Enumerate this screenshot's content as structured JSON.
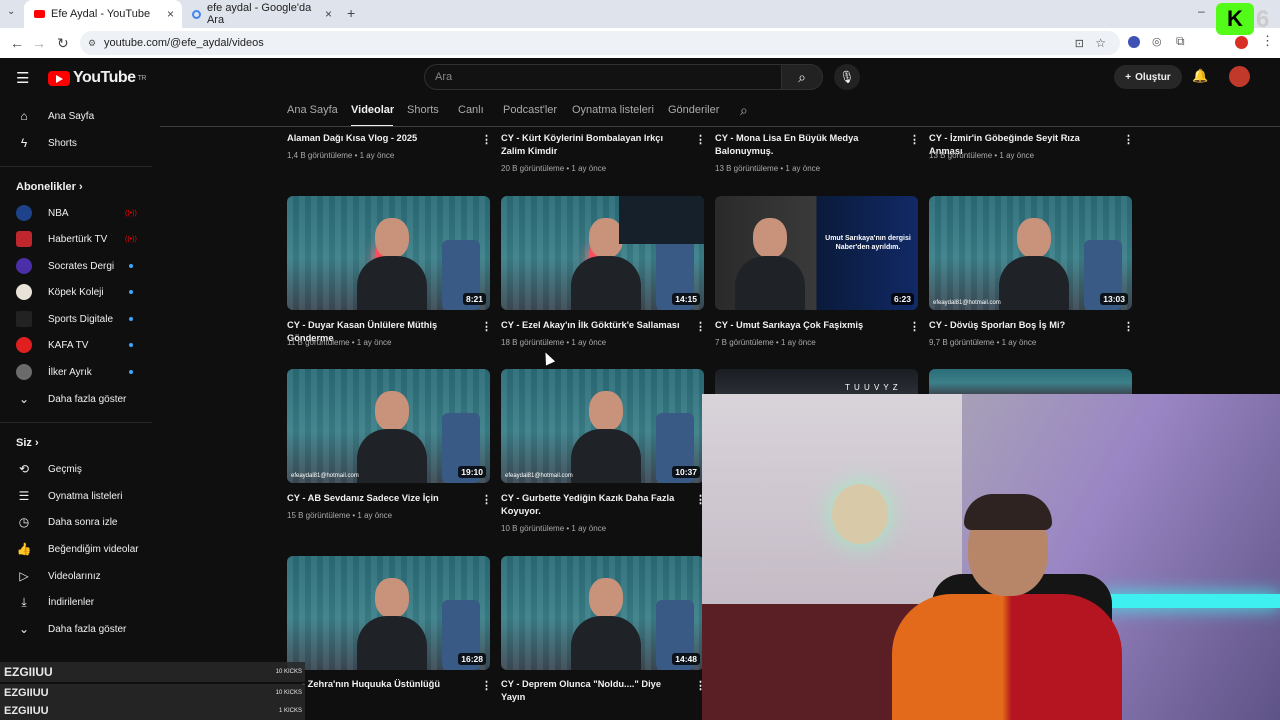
{
  "browser": {
    "tabs": [
      {
        "label": "Efe Aydal - YouTube",
        "close": "×"
      },
      {
        "label": "efe aydal - Google'da Ara",
        "close": "×"
      }
    ],
    "new_tab": "+",
    "url": "youtube.com/@efe_aydal/videos"
  },
  "youtube": {
    "logo_text": "YouTube",
    "logo_region": "TR",
    "search_placeholder": "Ara",
    "create_label": "Oluştur"
  },
  "sidebar": {
    "home": "Ana Sayfa",
    "shorts": "Shorts",
    "subscriptions_header": "Abonelikler",
    "subscriptions": [
      {
        "name": "NBA",
        "status": "live"
      },
      {
        "name": "Habertürk TV",
        "status": "live"
      },
      {
        "name": "Socrates Dergi",
        "status": "new"
      },
      {
        "name": "Köpek Koleji",
        "status": "new"
      },
      {
        "name": "Sports Digitale",
        "status": "new"
      },
      {
        "name": "KAFA TV",
        "status": "new"
      },
      {
        "name": "İlker Ayrık",
        "status": "new"
      }
    ],
    "show_more": "Daha fazla göster",
    "you_header": "Siz",
    "you_items": [
      "Geçmiş",
      "Oynatma listeleri",
      "Daha sonra izle",
      "Beğendiğim videolar",
      "Videolarınız",
      "İndirilenler",
      "Daha fazla göster"
    ]
  },
  "channel_tabs": [
    "Ana Sayfa",
    "Videolar",
    "Shorts",
    "Canlı",
    "Podcast'ler",
    "Oynatma listeleri",
    "Gönderiler"
  ],
  "videos_row1": [
    {
      "title": "Alaman Dağı Kısa Vlog - 2025",
      "meta": "1,4 B görüntüleme • 1 ay önce"
    },
    {
      "title": "CY - Kürt Köylerini Bombalayan Irkçı Zalim Kimdir",
      "meta": "20 B görüntüleme • 1 ay önce"
    },
    {
      "title": "CY - Mona Lisa En Büyük Medya Balonuymuş.",
      "meta": "13 B görüntüleme • 1 ay önce"
    },
    {
      "title": "CY - İzmir'in Göbeğinde Seyit Rıza Anması",
      "meta": "13 B görüntüleme • 1 ay önce"
    }
  ],
  "videos_row2": [
    {
      "title": "CY - Duyar Kasan Ünlülere Müthiş Gönderme",
      "meta": "11 B görüntüleme • 1 ay önce",
      "duration": "8:21"
    },
    {
      "title": "CY - Ezel Akay'ın İlk Göktürk'e Sallaması",
      "meta": "18 B görüntüleme • 1 ay önce",
      "duration": "14:15"
    },
    {
      "title": "CY - Umut Sarıkaya Çok Faşixmiş",
      "meta": "7 B görüntüleme • 1 ay önce",
      "duration": "6:23"
    },
    {
      "title": "CY - Dövüş Sporları Boş İş Mi?",
      "meta": "9,7 B görüntüleme • 1 ay önce",
      "duration": "13:03",
      "email": "efeaydal81@hotmail.com"
    }
  ],
  "videos_row3": [
    {
      "title": "CY - AB Sevdanız Sadece Vize İçin",
      "meta": "15 B görüntüleme • 1 ay önce",
      "duration": "19:10",
      "email": "efeaydal81@hotmail.com"
    },
    {
      "title": "CY - Gurbette Yediğin Kazık Daha Fazla Koyuyor.",
      "meta": "10 B görüntüleme • 1 ay önce",
      "duration": "10:37",
      "email": "efeaydal81@hotmail.com"
    }
  ],
  "videos_row4": [
    {
      "title": "- Zehra'nın Huquuka Üstünlüğü",
      "duration": "16:28"
    },
    {
      "title": "CY - Deprem Olunca \"Noldu....\" Diye Yayın",
      "duration": "14:48"
    }
  ],
  "thumb_texts": {
    "sarikaya_caption": "Umut Sarıkaya'nın dergisi Naber'den ayrıldım.",
    "row3_partial": "T U U V Y Z"
  },
  "kicks": [
    {
      "name": "EZGIIUU",
      "count": "10 KICKS"
    },
    {
      "name": "EZGIIUU",
      "count": "10 KICKS"
    },
    {
      "name": "EZGIIUU",
      "count": "1 KICKS"
    }
  ],
  "overlay": {
    "kick_logo": "K",
    "kick_number": "6"
  }
}
